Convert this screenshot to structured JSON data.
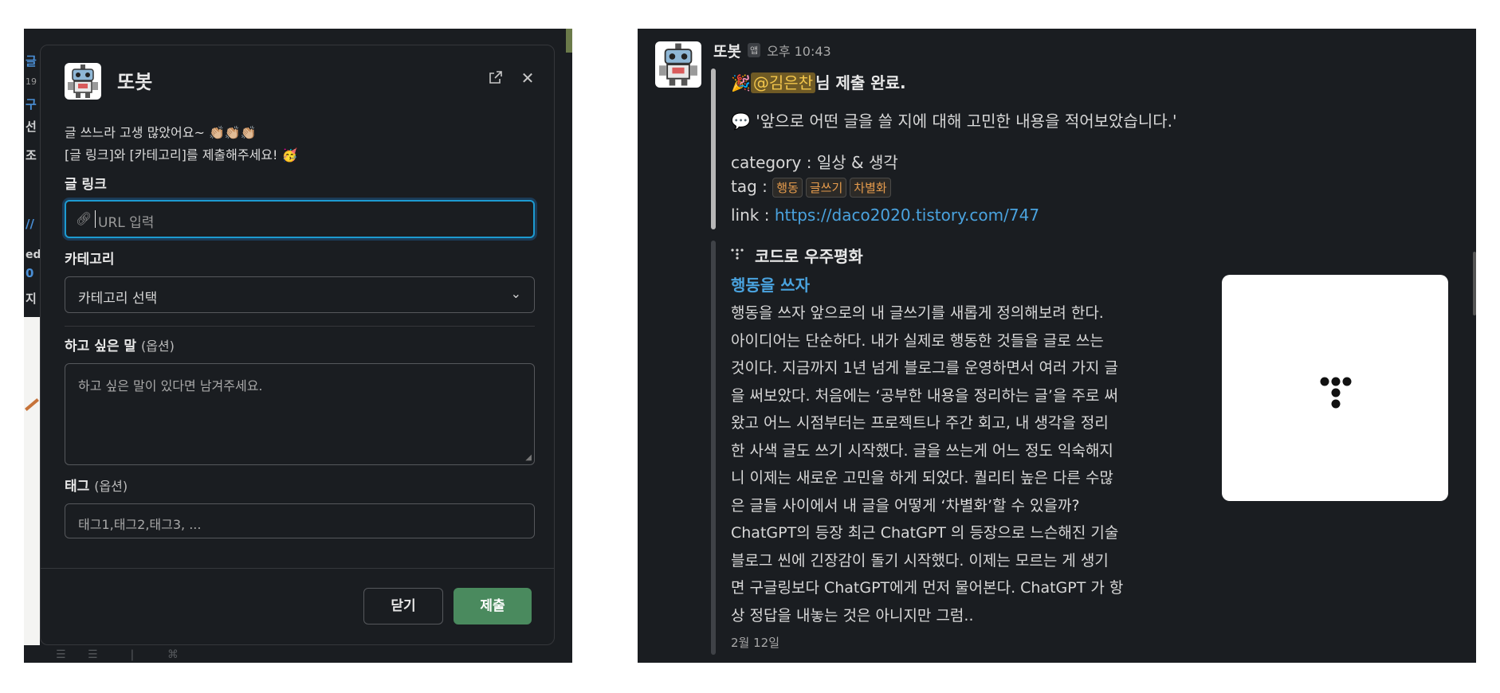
{
  "modal": {
    "title": "또봇",
    "intro_line1": "글 쓰느라 고생 많았어요~ 👏🏼👏🏼👏🏼",
    "intro_line2": "[글 링크]와 [카테고리]를 제출해주세요! 🥳",
    "link_label": "글 링크",
    "link_placeholder": "URL 입력",
    "category_label": "카테고리",
    "category_value": "카테고리 선택",
    "message_label": "하고 싶은 말",
    "message_optional": "(옵션)",
    "message_placeholder": "하고 싶은 말이 있다면 남겨주세요.",
    "tag_label": "태그",
    "tag_optional": "(옵션)",
    "tag_placeholder": "태그1,태그2,태그3, ...",
    "close_label": "닫기",
    "submit_label": "제출",
    "icons": {
      "link": "link-icon",
      "external": "external-link-icon",
      "close": "close-icon",
      "chevron": "chevron-down-icon"
    }
  },
  "background": {
    "fragments": [
      "글",
      "19",
      "구",
      "선",
      "조",
      "//",
      "ed",
      "0",
      "지"
    ]
  },
  "message": {
    "sender": "또봇",
    "badge": "앱",
    "time": "오후 10:43",
    "mention": "@김은찬",
    "headline_suffix": "님 제출 완료.",
    "quote": "'앞으로 어떤 글을 쓸 지에 대해 고민한 내용을 적어보았습니다.'",
    "category_line": "category : 일상 & 생각",
    "tag_prefix": "tag : ",
    "tags": [
      "행동",
      "글쓰기",
      "차별화"
    ],
    "link_prefix": "link : ",
    "link_url": "https://daco2020.tistory.com/747"
  },
  "preview": {
    "site_name": "코드로 우주평화",
    "post_title": "행동을 쓰자",
    "body_lines": [
      "행동을 쓰자 앞으로의 내 글쓰기를 새롭게 정의해보려 한다.",
      "아이디어는 단순하다. 내가 실제로 행동한 것들을 글로 쓰는",
      "것이다. 지금까지 1년 넘게 블로그를 운영하면서 여러 가지 글",
      "을 써보았다. 처음에는 ‘공부한 내용을 정리하는 글’을 주로 써",
      "왔고 어느 시점부터는 프로젝트나 주간 회고, 내 생각을 정리",
      "한 사색 글도 쓰기 시작했다. 글을 쓰는게 어느 정도 익숙해지",
      "니 이제는 새로운 고민을 하게 되었다. 퀄리티 높은 다른 수많",
      "은 글들 사이에서 내 글을 어떻게 ‘차별화’할 수 있을까?",
      "ChatGPT의 등장 최근 ChatGPT 의 등장으로 느슨해진 기술",
      "블로그 씬에 긴장감이 돌기 시작했다. 이제는 모르는 게 생기",
      "면 구글링보다 ChatGPT에게 먼저 물어본다. ChatGPT 가 항",
      "상 정답을 내놓는 것은 아니지만 그럼.."
    ],
    "date": "2월 12일"
  },
  "colors": {
    "accent_blue": "#1d9bd1",
    "submit_green": "#4a8a5e",
    "mention_bg": "#6f5a25",
    "link_blue": "#4aa3df",
    "tag_orange": "#e59b4c"
  }
}
